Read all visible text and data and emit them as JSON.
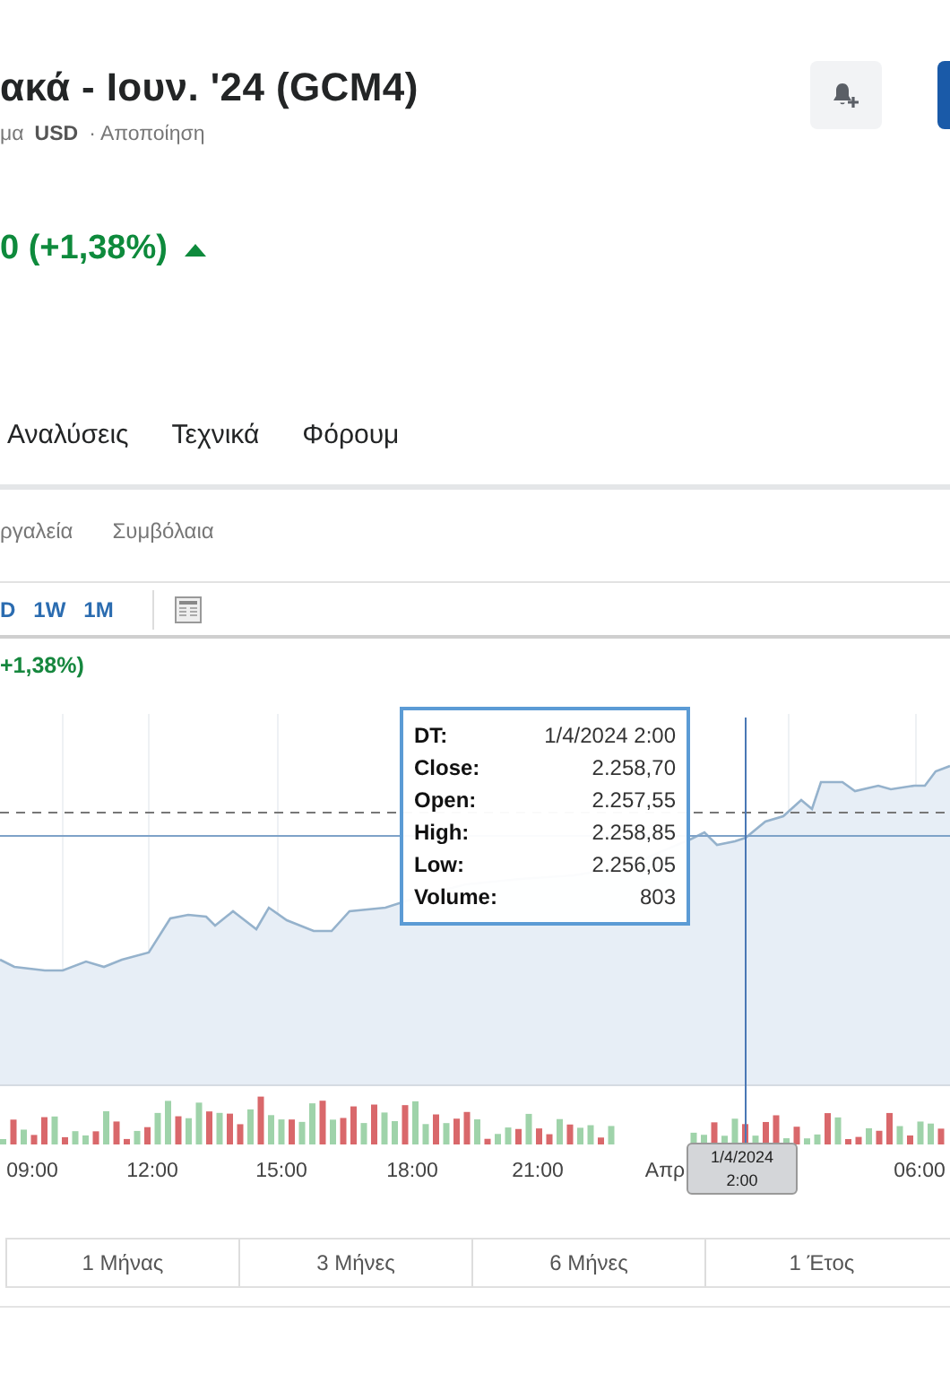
{
  "header": {
    "title": "ακά - Ιουν. '24 (GCM4)",
    "subtitle": {
      "prefix": "μα",
      "currency": "USD",
      "disclaimer": "· Αποποίηση"
    },
    "change": "0 (+1,38%)",
    "up": true
  },
  "tabs": [
    "Αναλύσεις",
    "Τεχνικά",
    "Φόρουμ"
  ],
  "subtabs": [
    "ργαλεία",
    "Συμβόλαια"
  ],
  "ranges": [
    "D",
    "1W",
    "1M"
  ],
  "chart": {
    "change": "+1,38%)",
    "x_labels": [
      "09:00",
      "12:00",
      "15:00",
      "18:00",
      "21:00",
      "Απρ",
      "06:00"
    ],
    "tooltip": [
      {
        "label": "DT:",
        "value": "1/4/2024 2:00"
      },
      {
        "label": "Close:",
        "value": "2.258,70"
      },
      {
        "label": "Open:",
        "value": "2.257,55"
      },
      {
        "label": "High:",
        "value": "2.258,85"
      },
      {
        "label": "Low:",
        "value": "2.256,05"
      },
      {
        "label": "Volume:",
        "value": "803"
      }
    ],
    "cursor_tag": [
      "1/4/2024",
      "2:00"
    ]
  },
  "periods": [
    "1 Μήνας",
    "3 Μήνες",
    "6 Μήνες",
    "1 Έτος"
  ]
}
